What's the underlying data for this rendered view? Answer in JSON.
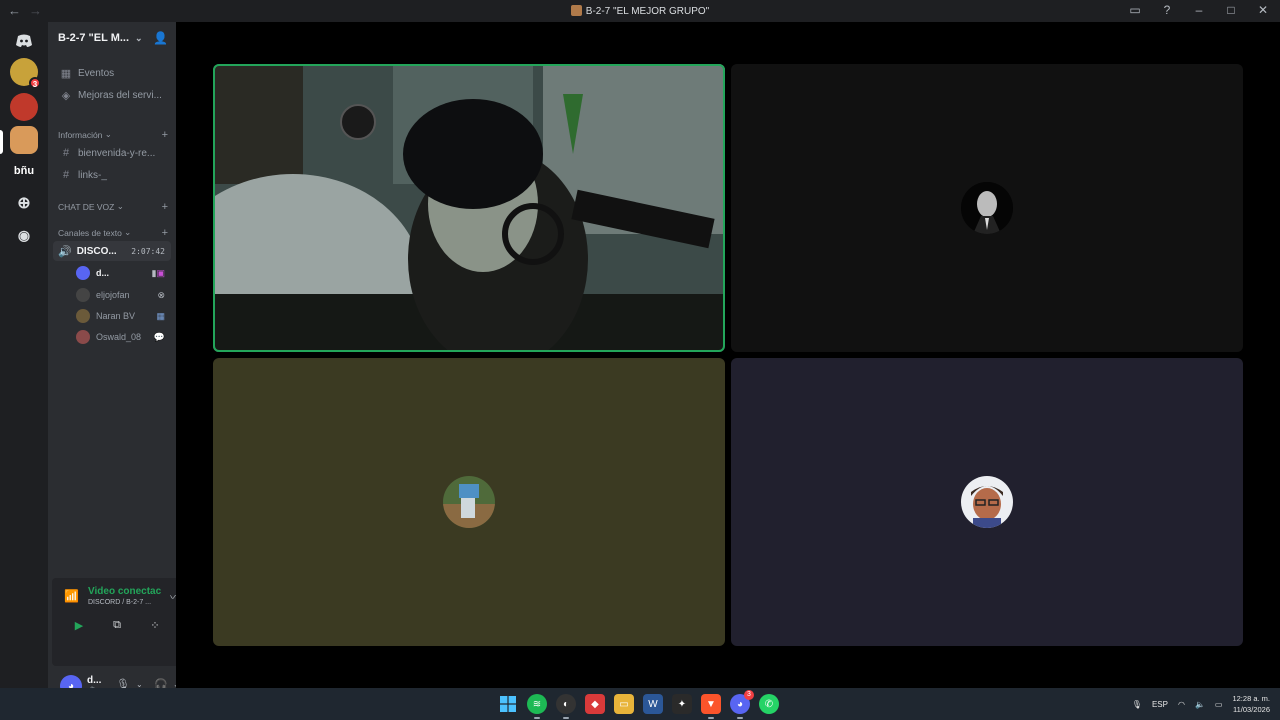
{
  "window": {
    "title": "B-2-7 \"EL MEJOR GRUPO\"",
    "nav_back": "←",
    "nav_forward": "→"
  },
  "rail": {
    "dm_icon": "discord-logo",
    "servers": [
      {
        "name": "server-1",
        "badge": "3",
        "color": "#c8a23a"
      },
      {
        "name": "server-2",
        "badge": "",
        "color": "#c0392b"
      },
      {
        "name": "server-3",
        "badge": "",
        "color": "#d99a5a"
      }
    ],
    "text_server": "bñu"
  },
  "server": {
    "name": "B-2-7 \"EL M...",
    "events": "Eventos",
    "boosts": "Mejoras del servi...",
    "categories": {
      "info": "Información",
      "voice": "CHAT DE VOZ",
      "text": "Canales de texto"
    },
    "channels": [
      "bienvenida-y-re...",
      "links-_"
    ],
    "voice_channel": {
      "name": "DISCO...",
      "time": "2:07:42"
    },
    "members": [
      {
        "name": "d...",
        "color": "#5865f2",
        "bold": true
      },
      {
        "name": "eljojofan",
        "color": "#444"
      },
      {
        "name": "Naran BV",
        "color": "#6b5a3a"
      },
      {
        "name": "Oswald_08",
        "color": "#8a4a4a"
      }
    ]
  },
  "voice_panel": {
    "status": "Video conectac",
    "sub": "DISCORD / B-2-7 ..."
  },
  "user": {
    "name": "d...",
    "sub": "🔊 •"
  },
  "stage": {
    "tiles": [
      {
        "name": "webcam-tile",
        "bg": "#2d3a3a"
      },
      {
        "name": "eljojofan-tile",
        "bg": "#111111"
      },
      {
        "name": "naran-tile",
        "bg": "#3b3a22"
      },
      {
        "name": "oswald-tile",
        "bg": "#21202e"
      }
    ]
  },
  "taskbar": {
    "lang": "ESP",
    "time": "12:28 a. m.",
    "date": "11/03/2026",
    "discord_badge": "3"
  }
}
